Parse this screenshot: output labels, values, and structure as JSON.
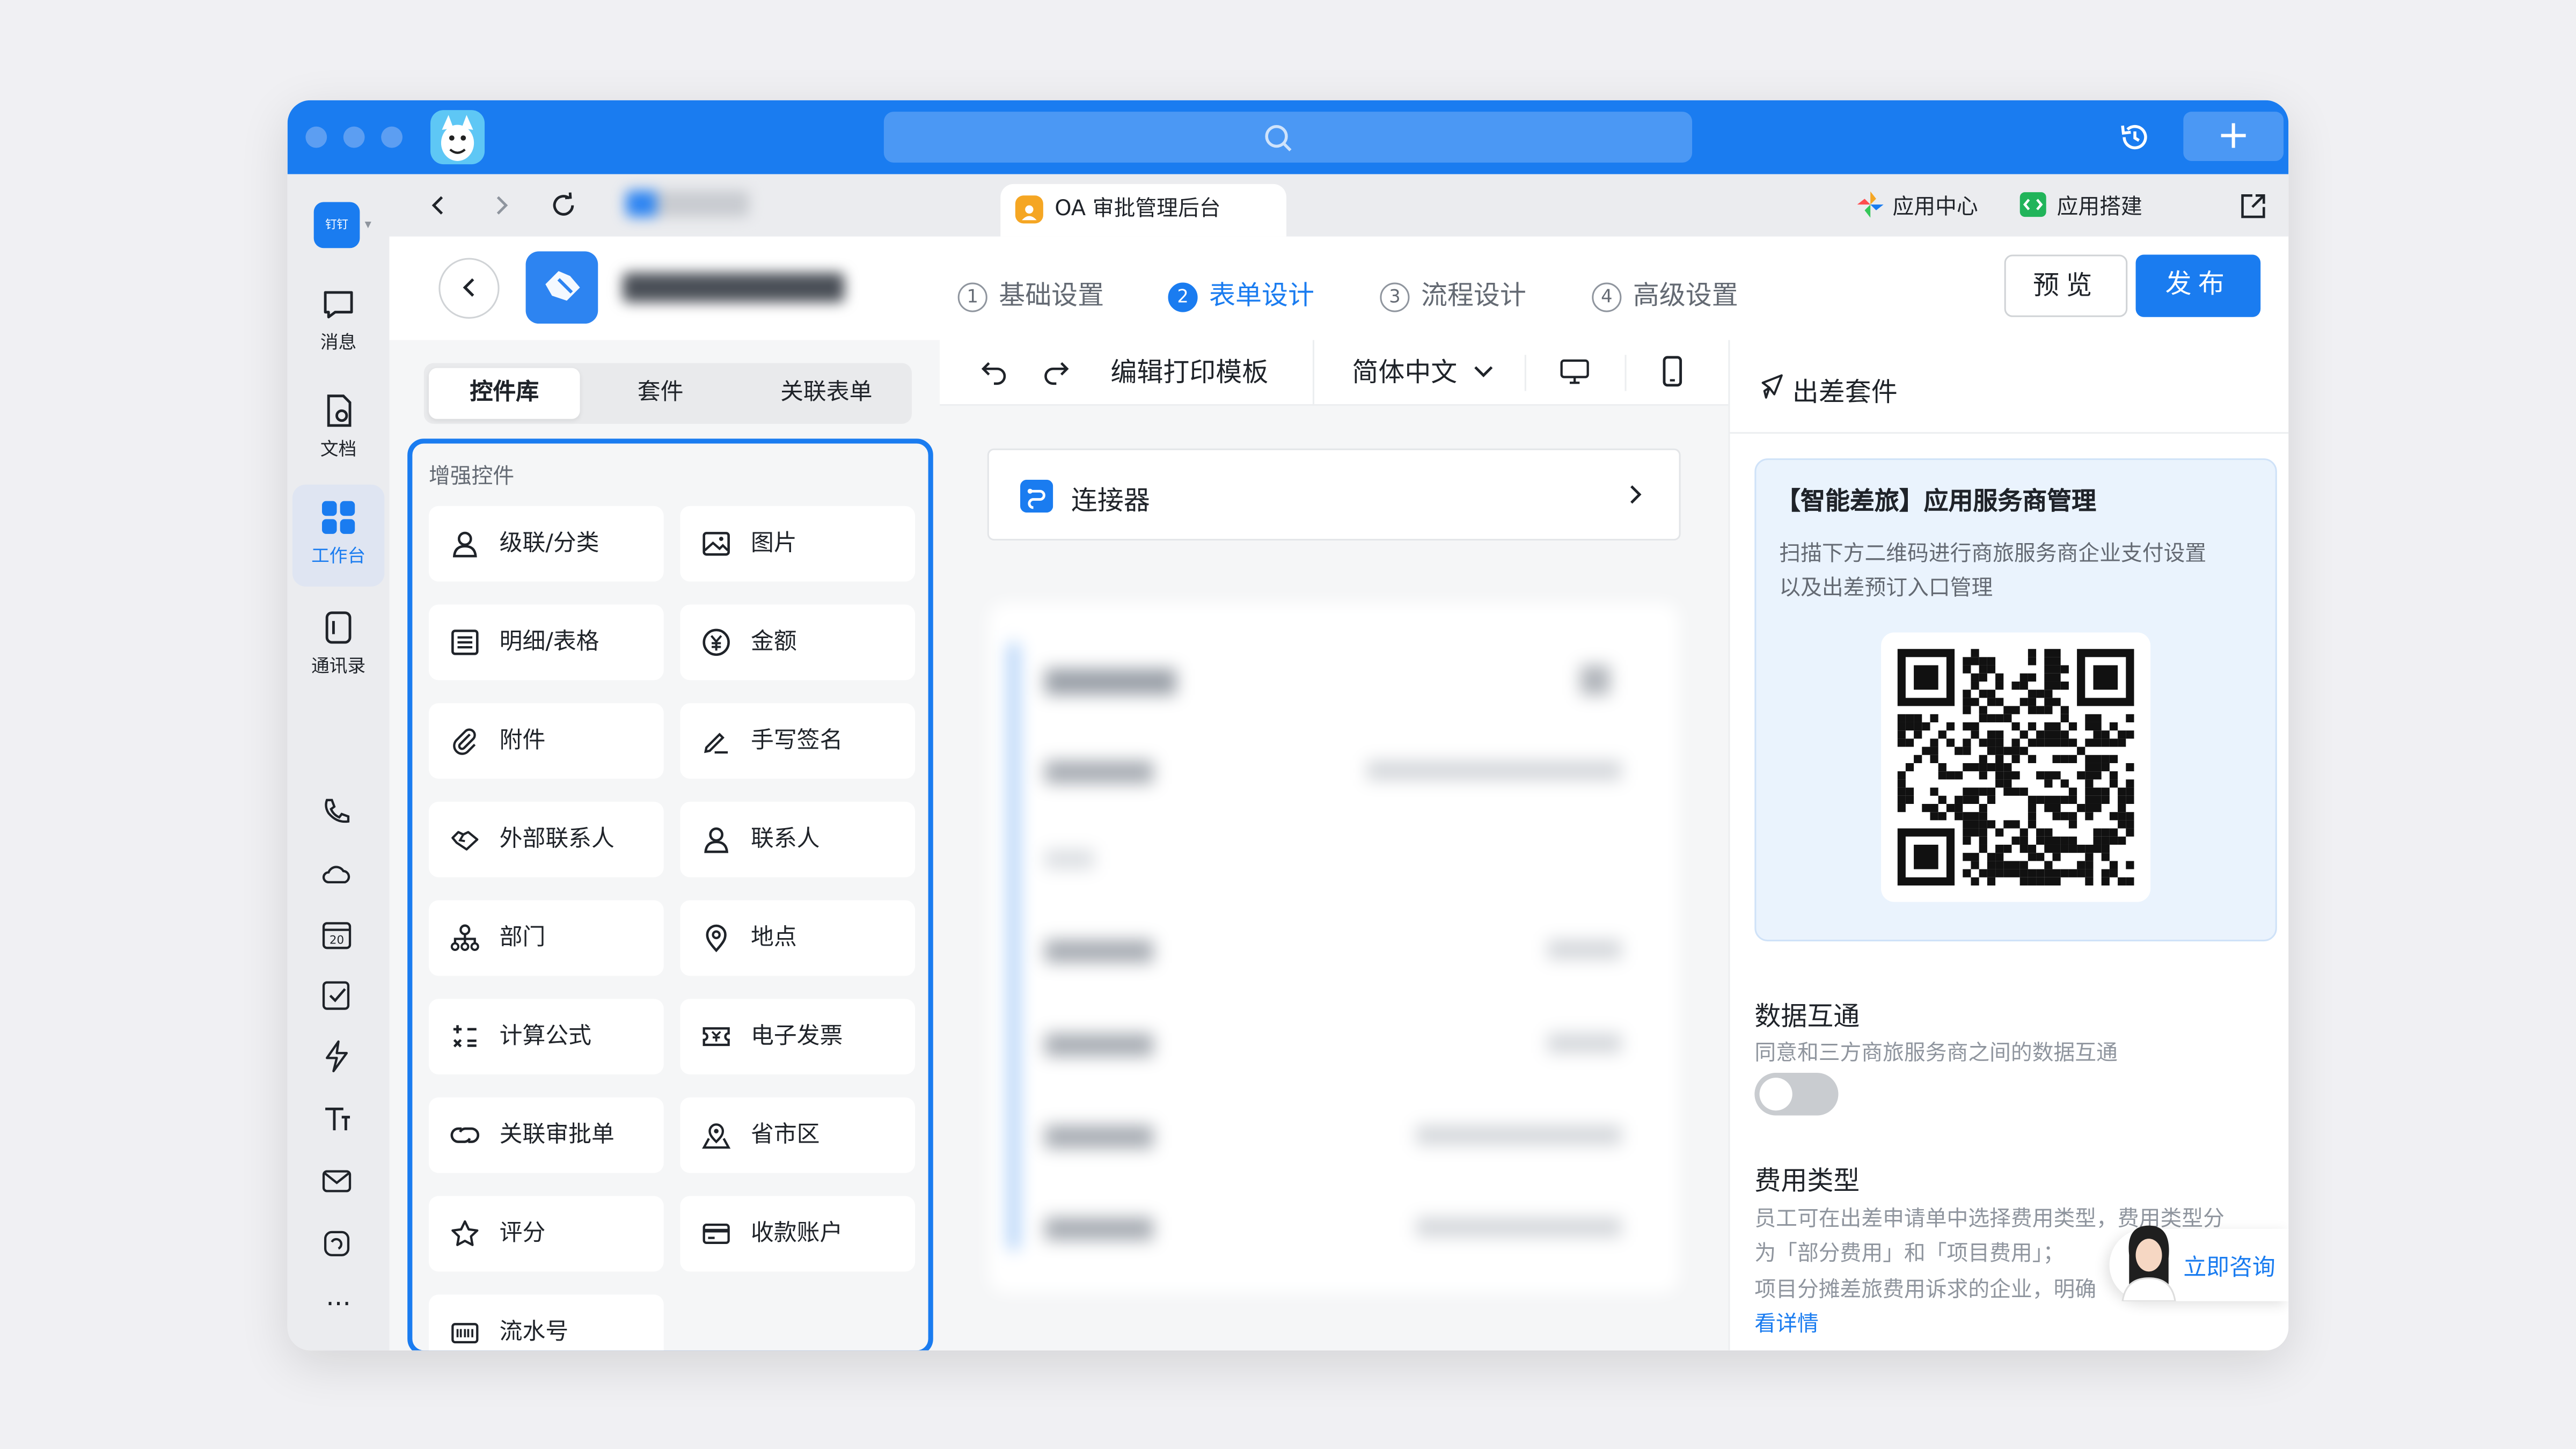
{
  "browser": {
    "tab_title": "OA 审批管理后台",
    "app_center": "应用中心",
    "app_build": "应用搭建"
  },
  "sidebar": {
    "badge": "钉钉",
    "items": [
      {
        "label": "消息",
        "icon": "message-icon"
      },
      {
        "label": "文档",
        "icon": "document-icon"
      },
      {
        "label": "工作台",
        "icon": "workbench-icon"
      },
      {
        "label": "通讯录",
        "icon": "contacts-icon"
      }
    ],
    "extra_icons": [
      "phone-icon",
      "cloud-icon",
      "calendar-icon",
      "todo-icon",
      "lightning-icon",
      "text-icon",
      "mail-icon",
      "notes-icon",
      "more-icon"
    ],
    "calendar_day": "20",
    "more_glyph": "···"
  },
  "header": {
    "steps": [
      {
        "num": "1",
        "label": "基础设置"
      },
      {
        "num": "2",
        "label": "表单设计"
      },
      {
        "num": "3",
        "label": "流程设计"
      },
      {
        "num": "4",
        "label": "高级设置"
      }
    ],
    "preview_label": "预览",
    "publish_label": "发布",
    "accent": "#1a7cf0"
  },
  "library": {
    "tabs": [
      "控件库",
      "套件",
      "关联表单"
    ],
    "section_title": "增强控件",
    "widgets": [
      {
        "label": "级联/分类",
        "icon": "person-icon"
      },
      {
        "label": "图片",
        "icon": "image-icon"
      },
      {
        "label": "明细/表格",
        "icon": "table-icon"
      },
      {
        "label": "金额",
        "icon": "yuan-icon"
      },
      {
        "label": "附件",
        "icon": "paperclip-icon"
      },
      {
        "label": "手写签名",
        "icon": "signature-icon"
      },
      {
        "label": "外部联系人",
        "icon": "handshake-icon"
      },
      {
        "label": "联系人",
        "icon": "contact-icon"
      },
      {
        "label": "部门",
        "icon": "org-icon"
      },
      {
        "label": "地点",
        "icon": "location-icon"
      },
      {
        "label": "计算公式",
        "icon": "formula-icon"
      },
      {
        "label": "电子发票",
        "icon": "invoice-icon"
      },
      {
        "label": "关联审批单",
        "icon": "link-icon"
      },
      {
        "label": "省市区",
        "icon": "map-pin-icon"
      },
      {
        "label": "评分",
        "icon": "star-icon"
      },
      {
        "label": "收款账户",
        "icon": "card-icon"
      },
      {
        "label": "流水号",
        "icon": "barcode-icon"
      }
    ]
  },
  "canvas": {
    "print_template": "编辑打印模板",
    "language": "简体中文",
    "connector": "连接器"
  },
  "suite": {
    "title": "出差套件",
    "promo_title": "【智能差旅】应用服务商管理",
    "promo_desc_1": "扫描下方二维码进行商旅服务商企业支付设置",
    "promo_desc_2": "以及出差预订入口管理",
    "data_title": "数据互通",
    "data_desc": "同意和三方商旅服务商之间的数据互通",
    "data_enabled": false,
    "fee_title": "费用类型",
    "fee_desc_1": "员工可在出差申请单中选择费用类型，费用类型分",
    "fee_desc_2": "为「部分费用」和「项目费用」；",
    "fee_desc_3": "项目分摊差旅费用诉求的企业，明确",
    "fee_link": "看详情",
    "consult": "立即咨询"
  }
}
